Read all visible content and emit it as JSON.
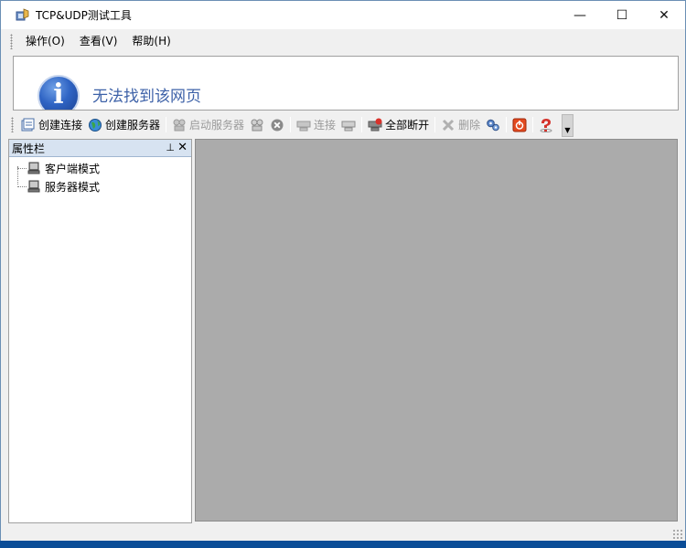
{
  "window": {
    "title": "TCP&UDP测试工具",
    "controls": {
      "minimize": "—",
      "maximize": "☐",
      "close": "✕"
    }
  },
  "menu": {
    "items": [
      "操作(O)",
      "查看(V)",
      "帮助(H)"
    ]
  },
  "browser": {
    "heading": "无法找到该网页",
    "icon_letter": "i"
  },
  "toolbar": {
    "create_connection": "创建连接",
    "create_server": "创建服务器",
    "start_server": "启动服务器",
    "connect": "连接",
    "disconnect_all": "全部断开",
    "delete": "删除",
    "overflow": "▼"
  },
  "props": {
    "title": "属性栏",
    "pin": "⊥",
    "close": "✕",
    "tree": [
      "客户端模式",
      "服务器模式"
    ]
  }
}
